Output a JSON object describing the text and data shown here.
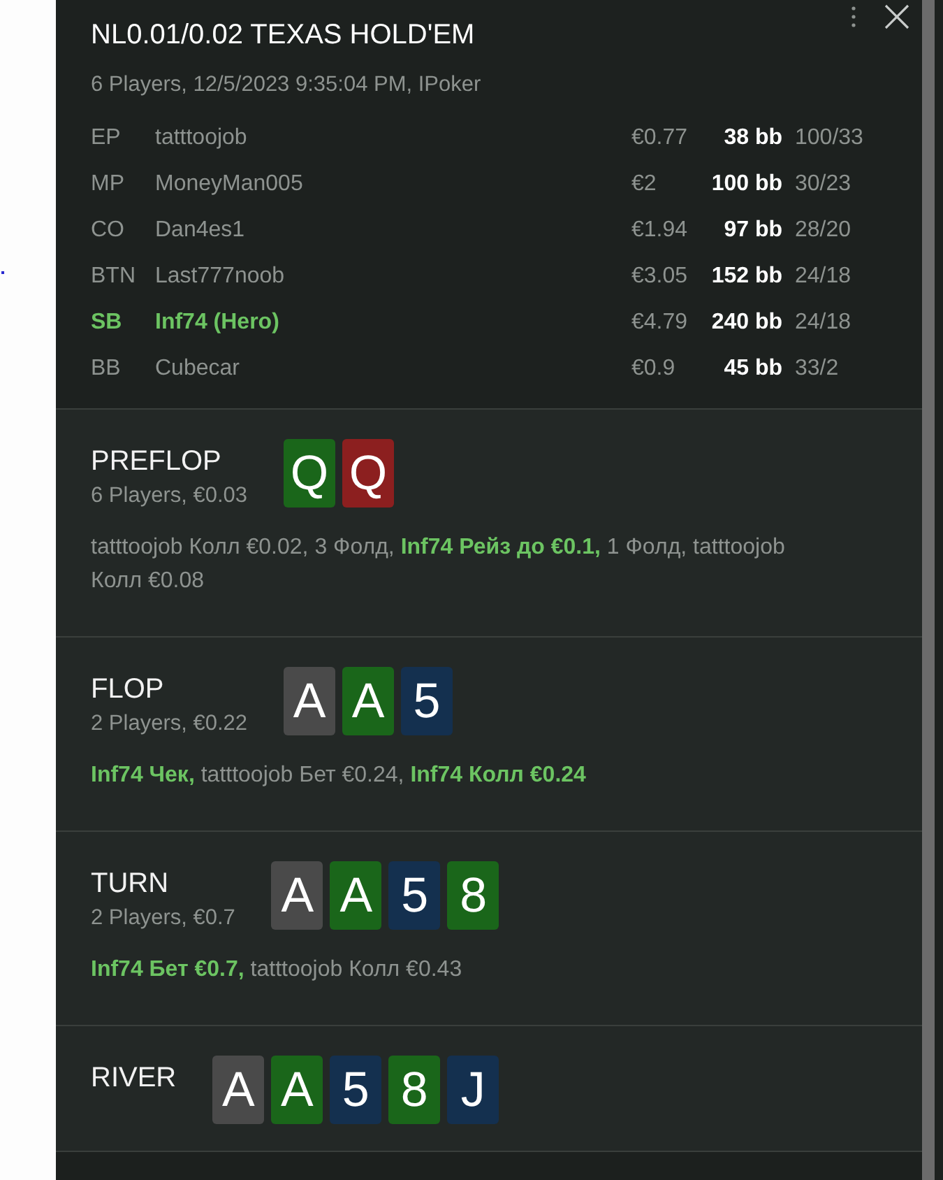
{
  "header": {
    "title": "NL0.01/0.02 TEXAS HOLD'EM",
    "subtitle": "6 Players, 12/5/2023 9:35:04 PM, IPoker"
  },
  "players": [
    {
      "position": "EP",
      "name": "tatttoojob",
      "stack": "€0.77",
      "stack_bb": "38 bb",
      "stats": "100/33",
      "hero": false
    },
    {
      "position": "MP",
      "name": "MoneyMan005",
      "stack": "€2",
      "stack_bb": "100 bb",
      "stats": "30/23",
      "hero": false
    },
    {
      "position": "CO",
      "name": "Dan4es1",
      "stack": "€1.94",
      "stack_bb": "97 bb",
      "stats": "28/20",
      "hero": false
    },
    {
      "position": "BTN",
      "name": "Last777noob",
      "stack": "€3.05",
      "stack_bb": "152 bb",
      "stats": "24/18",
      "hero": false
    },
    {
      "position": "SB",
      "name": "Inf74 (Hero)",
      "stack": "€4.79",
      "stack_bb": "240 bb",
      "stats": "24/18",
      "hero": true
    },
    {
      "position": "BB",
      "name": "Cubecar",
      "stack": "€0.9",
      "stack_bb": "45 bb",
      "stats": "33/2",
      "hero": false
    }
  ],
  "streets": [
    {
      "name": "PREFLOP",
      "summary": "6 Players, €0.03",
      "cards": [
        {
          "rank": "Q",
          "color": "#1a661a"
        },
        {
          "rank": "Q",
          "color": "#8c1f1f"
        }
      ],
      "actions": [
        {
          "text": "tatttoojob Колл €0.02, 3 Фолд,",
          "hero": false
        },
        {
          "text": "Inf74 Рейз до €0.1,",
          "hero": true
        },
        {
          "text": "1 Фолд, tatttoojob Колл €0.08",
          "hero": false
        }
      ]
    },
    {
      "name": "FLOP",
      "summary": "2 Players, €0.22",
      "cards": [
        {
          "rank": "A",
          "color": "#4a4a4a"
        },
        {
          "rank": "A",
          "color": "#1a661a"
        },
        {
          "rank": "5",
          "color": "#14304f"
        }
      ],
      "actions": [
        {
          "text": "Inf74 Чек,",
          "hero": true
        },
        {
          "text": "tatttoojob Бет €0.24,",
          "hero": false
        },
        {
          "text": "Inf74 Колл €0.24",
          "hero": true
        }
      ]
    },
    {
      "name": "TURN",
      "summary": "2 Players, €0.7",
      "cards": [
        {
          "rank": "A",
          "color": "#4a4a4a"
        },
        {
          "rank": "A",
          "color": "#1a661a"
        },
        {
          "rank": "5",
          "color": "#14304f"
        },
        {
          "rank": "8",
          "color": "#1a661a"
        }
      ],
      "actions": [
        {
          "text": "Inf74 Бет €0.7,",
          "hero": true
        },
        {
          "text": "tatttoojob Колл €0.43",
          "hero": false
        }
      ]
    },
    {
      "name": "RIVER",
      "cards": [
        {
          "rank": "A",
          "color": "#4a4a4a"
        },
        {
          "rank": "A",
          "color": "#1a661a"
        },
        {
          "rank": "5",
          "color": "#14304f"
        },
        {
          "rank": "8",
          "color": "#1a661a"
        },
        {
          "rank": "J",
          "color": "#14304f"
        }
      ]
    }
  ]
}
